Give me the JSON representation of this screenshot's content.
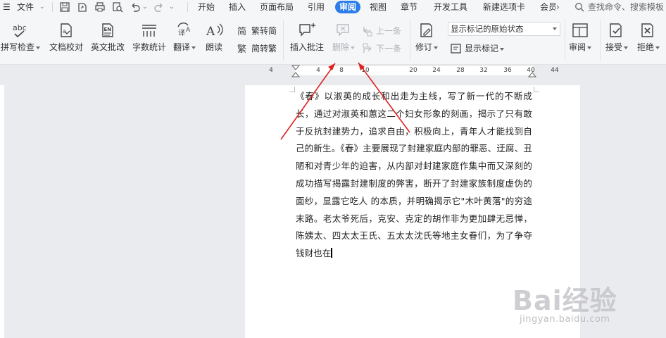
{
  "menubar": {
    "file_label": "文件",
    "tabs": [
      "开始",
      "插入",
      "页面布局",
      "引用",
      "审阅",
      "视图",
      "章节",
      "开发工具",
      "新建选项卡",
      "会员"
    ],
    "search_placeholder": "查找命令、搜索模板"
  },
  "ribbon": {
    "spell_check": "拼写检查",
    "doc_proof": "文档校对",
    "en_review": "英文批改",
    "word_count": "字数统计",
    "translate": "翻译",
    "read_aloud": "朗读",
    "trad_to_simp": "繁转简",
    "simp_to_trad": "简转繁",
    "insert_comment": "插入批注",
    "delete": "删除",
    "prev": "上一条",
    "next": "下一条",
    "track_changes": "修订",
    "display_state": "显示标记的原始状态",
    "show_markup": "显示标记",
    "review_pane": "审阅",
    "accept": "接受",
    "reject": "拒绝"
  },
  "ruler": {
    "labels": [
      "4",
      "4",
      "8",
      "10",
      "20",
      "24",
      "28",
      "32",
      "36",
      "40",
      "44"
    ]
  },
  "document": {
    "paragraph": "《春》以淑英的成长和出走为主线，写了新一代的不断成长，通过对淑英和蕙这二个妇女形象的刻画，揭示了只有敢于反抗封建势力，追求自由，积极向上，青年人才能找到自己的新生。《春》主要展现了封建家庭内部的罪恶、迂腐、丑陋和对青少年的迫害，从内部对封建家庭作集中而又深刻的成功描写揭露封建制度的弊害，断开了封建家族制度虚伪的面纱，显露它吃人 的本质，并明确揭示它\"木叶黄落\"的穷途末路。老太爷死后，克安、克定的胡作非为更加肆无忌惮，陈姨太、四太太王氏、五太太沈氏等地主女眷们，为了争夺钱财也在"
  },
  "watermark": {
    "logo": "Bai经验",
    "url": "jingyan.baidu.com"
  },
  "colors": {
    "accent": "#2b7de9",
    "arrow": "#e02020"
  }
}
